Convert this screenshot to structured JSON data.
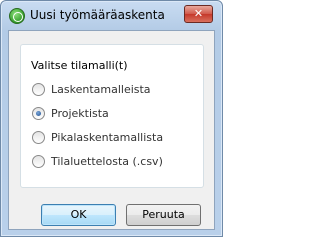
{
  "window": {
    "title": "Uusi työmääräaskenta",
    "close_label": "✕"
  },
  "group": {
    "label": "Valitse tilamalli(t)",
    "options": [
      {
        "label": "Laskentamalleista",
        "checked": false
      },
      {
        "label": "Projektista",
        "checked": true
      },
      {
        "label": "Pikalaskentamallista",
        "checked": false
      },
      {
        "label": "Tilaluettelosta (.csv)",
        "checked": false
      }
    ]
  },
  "buttons": {
    "ok_label": "OK",
    "cancel_label": "Peruuta"
  },
  "colors": {
    "title_bar": "#c9dcf2",
    "close_button": "#c5382a",
    "dialog_background": "#f0f0f0",
    "default_button_border": "#3c7fb1"
  }
}
